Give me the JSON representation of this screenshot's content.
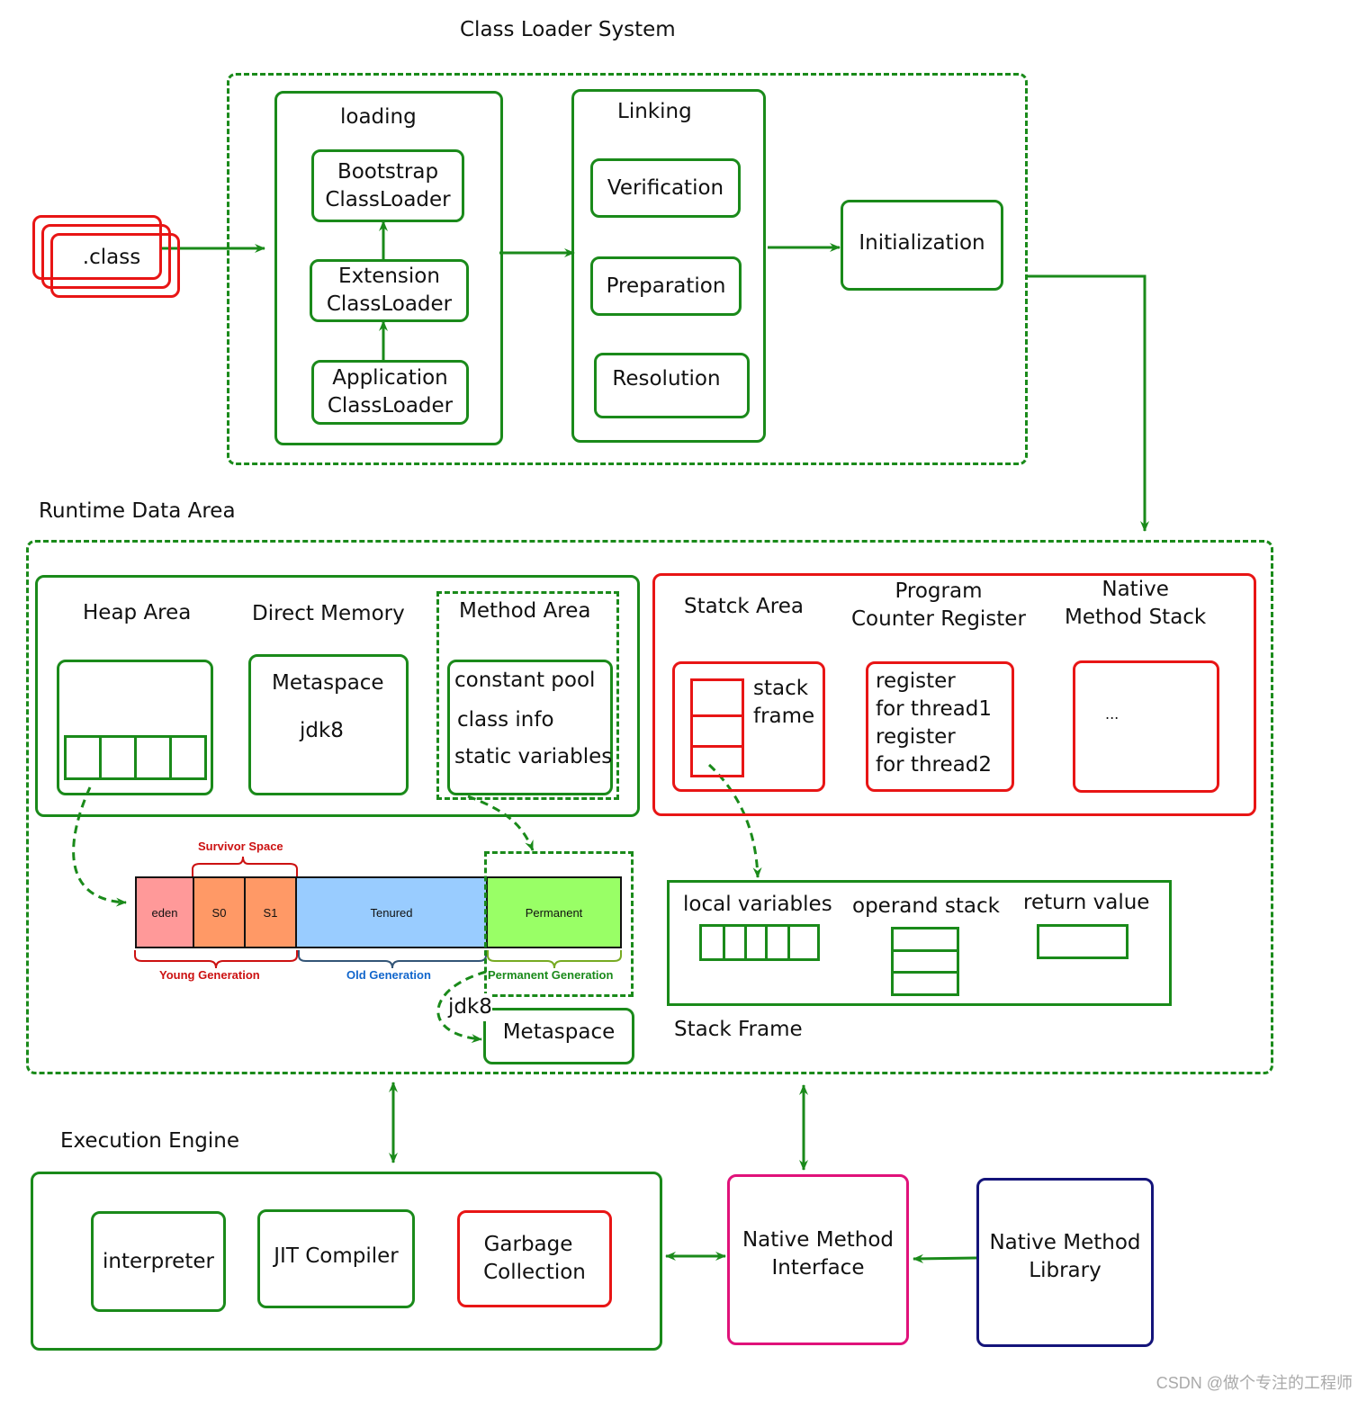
{
  "colors": {
    "green": "#1a8a1a",
    "red": "#e81515",
    "pink": "#e0127a",
    "navy": "#14147a",
    "eden": "#ff9999",
    "survivor": "#ff9966",
    "tenured": "#99ccff",
    "permanent": "#99ff66"
  },
  "class_loader": {
    "title": "Class Loader System",
    "file_label": ".class",
    "loading": {
      "title": "loading",
      "bootstrap": [
        "Bootstrap",
        "ClassLoader"
      ],
      "extension": [
        "Extension",
        "ClassLoader"
      ],
      "application": [
        "Application",
        "ClassLoader"
      ]
    },
    "linking": {
      "title": "Linking",
      "verification": "Verification",
      "preparation": "Preparation",
      "resolution": "Resolution"
    },
    "initialization": "Initialization"
  },
  "runtime": {
    "title": "Runtime Data Area",
    "heap": "Heap Area",
    "direct_memory": "Direct Memory",
    "direct_meta": "Metaspace",
    "direct_jdk": "jdk8",
    "method_area": "Method Area",
    "method_items": [
      "constant pool",
      "class info",
      "static variables"
    ],
    "stack_area": "Statck Area",
    "stack_frame_label": [
      "stack",
      "frame"
    ],
    "pc_register": [
      "Program",
      "Counter Register"
    ],
    "pc_items": [
      "register",
      "for thread1",
      "register",
      "for thread2"
    ],
    "native_stack": [
      "Native",
      "Method Stack"
    ],
    "native_stack_content": "...",
    "generations": {
      "survivor": "Survivor Space",
      "eden": "eden",
      "s0": "S0",
      "s1": "S1",
      "tenured": "Tenured",
      "permanent": "Permanent",
      "young": "Young Generation",
      "old": "Old Generation",
      "perm_gen": "Permanent Generation"
    },
    "jdk8": "jdk8",
    "metaspace": "Metaspace",
    "stack_frame": {
      "title": "Stack Frame",
      "local": "local variables",
      "operand": "operand stack",
      "return": "return value"
    }
  },
  "execution": {
    "title": "Execution Engine",
    "interpreter": "interpreter",
    "jit": "JIT Compiler",
    "gc": [
      "Garbage",
      "Collection"
    ]
  },
  "native_interface": [
    "Native Method",
    "Interface"
  ],
  "native_library": [
    "Native Method",
    "Library"
  ],
  "watermark": "CSDN @做个专注的工程师"
}
